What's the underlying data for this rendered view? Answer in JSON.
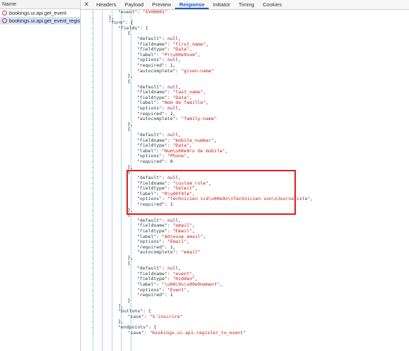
{
  "left_panel": {
    "header": "Name",
    "requests": [
      {
        "label": "bookings.ui.api.get_event",
        "selected": false
      },
      {
        "label": "bookings.ui.api.get_event_regis...",
        "selected": true
      }
    ]
  },
  "tabs": {
    "close_icon": "close-icon",
    "items": [
      "Headers",
      "Payload",
      "Preview",
      "Response",
      "Initiator",
      "Timing",
      "Cookies"
    ],
    "active": "Response"
  },
  "response_lines": [
    {
      "indent": 4,
      "text": "\"event\": \"EV00001\""
    },
    {
      "indent": 3,
      "text": "},"
    },
    {
      "indent": 3,
      "text": "\"form\": {"
    },
    {
      "indent": 4,
      "text": "\"fields\": ["
    },
    {
      "indent": 5,
      "text": "{"
    },
    {
      "indent": 6,
      "text": "\"default\": null,"
    },
    {
      "indent": 6,
      "text": "\"fieldname\": \"first_name\","
    },
    {
      "indent": 6,
      "text": "\"fieldtype\": \"Data\","
    },
    {
      "indent": 6,
      "text": "\"label\": \"Pr\\u00e9nom\","
    },
    {
      "indent": 6,
      "text": "\"options\": null,"
    },
    {
      "indent": 6,
      "text": "\"required\": 1,"
    },
    {
      "indent": 6,
      "text": "\"autocomplete\": \"given-name\""
    },
    {
      "indent": 5,
      "text": "},"
    },
    {
      "indent": 5,
      "text": "{"
    },
    {
      "indent": 6,
      "text": "\"default\": null,"
    },
    {
      "indent": 6,
      "text": "\"fieldname\": \"last_name\","
    },
    {
      "indent": 6,
      "text": "\"fieldtype\": \"Data\","
    },
    {
      "indent": 6,
      "text": "\"label\": \"Nom de famille\","
    },
    {
      "indent": 6,
      "text": "\"options\": null,"
    },
    {
      "indent": 6,
      "text": "\"required\": 1,"
    },
    {
      "indent": 6,
      "text": "\"autocomplete\": \"family-name\""
    },
    {
      "indent": 5,
      "text": "},"
    },
    {
      "indent": 5,
      "text": "{"
    },
    {
      "indent": 6,
      "text": "\"default\": null,"
    },
    {
      "indent": 6,
      "text": "\"fieldname\": \"mobile_number\","
    },
    {
      "indent": 6,
      "text": "\"fieldtype\": \"Data\","
    },
    {
      "indent": 6,
      "text": "\"label\": \"Num\\u00e9ro de mobile\","
    },
    {
      "indent": 6,
      "text": "\"options\": \"Phone\","
    },
    {
      "indent": 6,
      "text": "\"required\": 0"
    },
    {
      "indent": 5,
      "text": "},"
    },
    {
      "indent": 5,
      "text": "{"
    },
    {
      "indent": 6,
      "text": "\"default\": null,"
    },
    {
      "indent": 6,
      "text": "\"fieldname\": \"custom_role\","
    },
    {
      "indent": 6,
      "text": "\"fieldtype\": \"Select\","
    },
    {
      "indent": 6,
      "text": "\"label\": \"R\\u00f4le\","
    },
    {
      "indent": 6,
      "text": "\"options\": \"Technicien vid\\u00e9o\\nTechnicien son\\nJournaliste\","
    },
    {
      "indent": 6,
      "text": "\"required\": 1"
    },
    {
      "indent": 5,
      "text": "},"
    },
    {
      "indent": 5,
      "text": "{"
    },
    {
      "indent": 6,
      "text": "\"default\": null,"
    },
    {
      "indent": 6,
      "text": "\"fieldname\": \"email\","
    },
    {
      "indent": 6,
      "text": "\"fieldtype\": \"Email\","
    },
    {
      "indent": 6,
      "text": "\"label\": \"Adresse email\","
    },
    {
      "indent": 6,
      "text": "\"options\": \"Email\","
    },
    {
      "indent": 6,
      "text": "\"required\": 1,"
    },
    {
      "indent": 6,
      "text": "\"autocomplete\": \"email\""
    },
    {
      "indent": 5,
      "text": "},"
    },
    {
      "indent": 5,
      "text": "{"
    },
    {
      "indent": 6,
      "text": "\"default\": null,"
    },
    {
      "indent": 6,
      "text": "\"fieldname\": \"event\","
    },
    {
      "indent": 6,
      "text": "\"fieldtype\": \"Hidden\","
    },
    {
      "indent": 6,
      "text": "\"label\": \"\\u00c9v\\u00e9nement\","
    },
    {
      "indent": 6,
      "text": "\"options\": \"Event\","
    },
    {
      "indent": 6,
      "text": "\"required\": 1"
    },
    {
      "indent": 5,
      "text": "}"
    },
    {
      "indent": 4,
      "text": "],"
    },
    {
      "indent": 4,
      "text": "\"buttons\": {"
    },
    {
      "indent": 5,
      "text": "\"save\": \"S'inscrire\""
    },
    {
      "indent": 4,
      "text": "},"
    },
    {
      "indent": 4,
      "text": "\"endpoints\": {"
    },
    {
      "indent": 5,
      "text": "\"save\": \"bookings.ui.api.register_to_event\""
    }
  ],
  "colors": {
    "string": "#c41a16",
    "number": "#1c00cf",
    "keyword": "#881280",
    "highlight_box": "#e01b1b",
    "active_tab": "#1a56c4"
  }
}
